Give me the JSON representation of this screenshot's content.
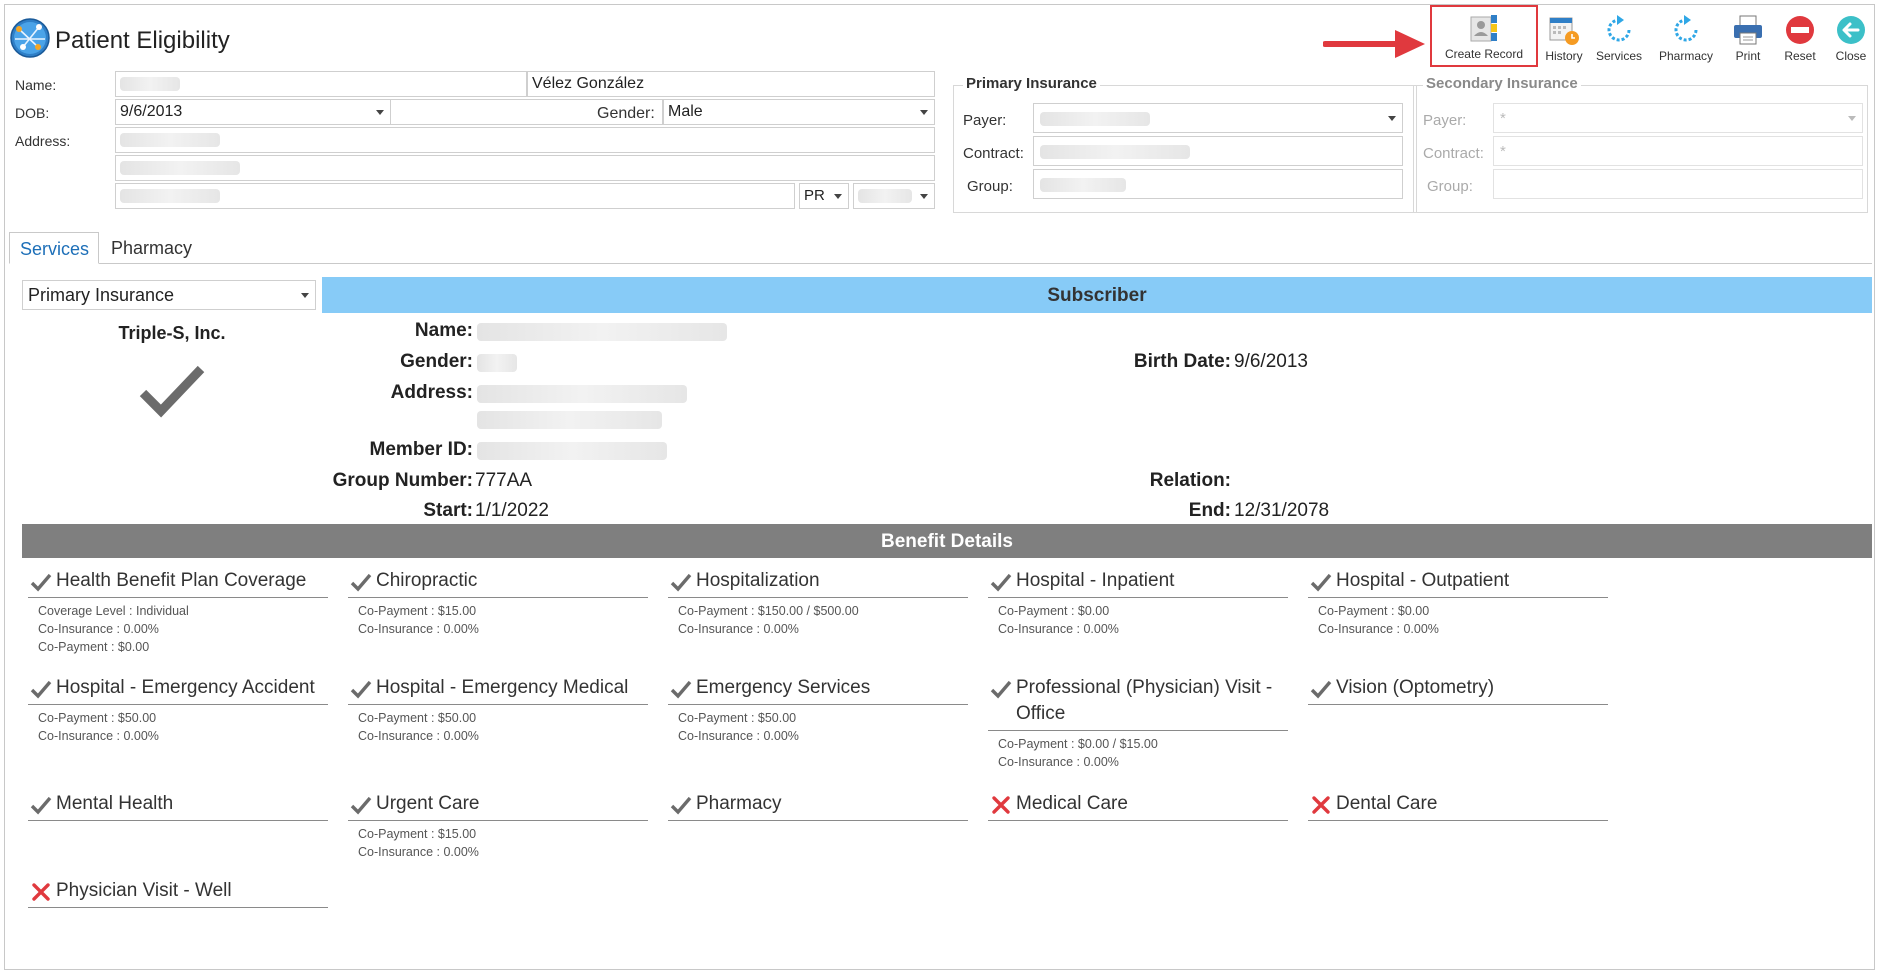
{
  "header": {
    "title": "Patient Eligibility"
  },
  "toolbar": {
    "create_record": "Create Record",
    "history": "History",
    "services": "Services",
    "pharmacy": "Pharmacy",
    "print": "Print",
    "reset": "Reset",
    "close": "Close"
  },
  "patient": {
    "name_label": "Name:",
    "last_name": "Vélez González",
    "dob_label": "DOB:",
    "dob": "9/6/2013",
    "gender_label": "Gender:",
    "gender": "Male",
    "address_label": "Address:",
    "state": "PR"
  },
  "primary_insurance": {
    "title": "Primary Insurance",
    "payer_label": "Payer:",
    "contract_label": "Contract:",
    "group_label": "Group:"
  },
  "secondary_insurance": {
    "title": "Secondary Insurance",
    "payer_label": "Payer:",
    "payer_placeholder": "*",
    "contract_label": "Contract:",
    "contract_placeholder": "*",
    "group_label": "Group:"
  },
  "tabs": [
    {
      "label": "Services",
      "active": true
    },
    {
      "label": "Pharmacy",
      "active": false
    }
  ],
  "services": {
    "insurance_select": "Primary Insurance",
    "payer_name": "Triple-S, Inc.",
    "subscriber_header": "Subscriber",
    "subscriber": {
      "name_label": "Name:",
      "gender_label": "Gender:",
      "birth_date_label": "Birth Date:",
      "birth_date": "9/6/2013",
      "address_label": "Address:",
      "member_id_label": "Member ID:",
      "group_number_label": "Group Number:",
      "group_number": "777AA",
      "relation_label": "Relation:",
      "start_label": "Start:",
      "start": "1/1/2022",
      "end_label": "End:",
      "end": "12/31/2078"
    },
    "benefit_header": "Benefit Details",
    "benefits": [
      {
        "title": "Health Benefit Plan Coverage",
        "status": "covered",
        "details": [
          "Coverage Level : Individual",
          "Co-Insurance : 0.00%",
          "Co-Payment : $0.00"
        ]
      },
      {
        "title": "Chiropractic",
        "status": "covered",
        "details": [
          "Co-Payment : $15.00",
          "Co-Insurance : 0.00%"
        ]
      },
      {
        "title": "Hospitalization",
        "status": "covered",
        "details": [
          "Co-Payment : $150.00 / $500.00",
          "Co-Insurance : 0.00%"
        ]
      },
      {
        "title": "Hospital - Inpatient",
        "status": "covered",
        "details": [
          "Co-Payment : $0.00",
          "Co-Insurance : 0.00%"
        ]
      },
      {
        "title": "Hospital - Outpatient",
        "status": "covered",
        "details": [
          "Co-Payment : $0.00",
          "Co-Insurance : 0.00%"
        ]
      },
      {
        "title": "Hospital - Emergency Accident",
        "status": "covered",
        "details": [
          "Co-Payment : $50.00",
          "Co-Insurance : 0.00%"
        ]
      },
      {
        "title": "Hospital - Emergency Medical",
        "status": "covered",
        "details": [
          "Co-Payment : $50.00",
          "Co-Insurance : 0.00%"
        ]
      },
      {
        "title": "Emergency Services",
        "status": "covered",
        "details": [
          "Co-Payment : $50.00",
          "Co-Insurance : 0.00%"
        ]
      },
      {
        "title": "Professional (Physician) Visit - Office",
        "status": "covered",
        "details": [
          "Co-Payment : $0.00 / $15.00",
          "Co-Insurance : 0.00%"
        ]
      },
      {
        "title": "Vision (Optometry)",
        "status": "covered",
        "details": []
      },
      {
        "title": "Mental Health",
        "status": "covered",
        "details": []
      },
      {
        "title": "Urgent Care",
        "status": "covered",
        "details": [
          "Co-Payment : $15.00",
          "Co-Insurance : 0.00%"
        ]
      },
      {
        "title": "Pharmacy",
        "status": "covered",
        "details": []
      },
      {
        "title": "Medical Care",
        "status": "not-covered",
        "details": []
      },
      {
        "title": "Dental Care",
        "status": "not-covered",
        "details": []
      },
      {
        "title": "Physician Visit - Well",
        "status": "not-covered",
        "details": []
      }
    ]
  },
  "colors": {
    "subscriber_header_bg": "#87cbf7",
    "benefit_header_bg": "#7f7f7f",
    "active_tab_text": "#1d6fb8",
    "check": "#6b6b6b",
    "cross": "#e0393e",
    "highlight_border": "#e0393e"
  }
}
